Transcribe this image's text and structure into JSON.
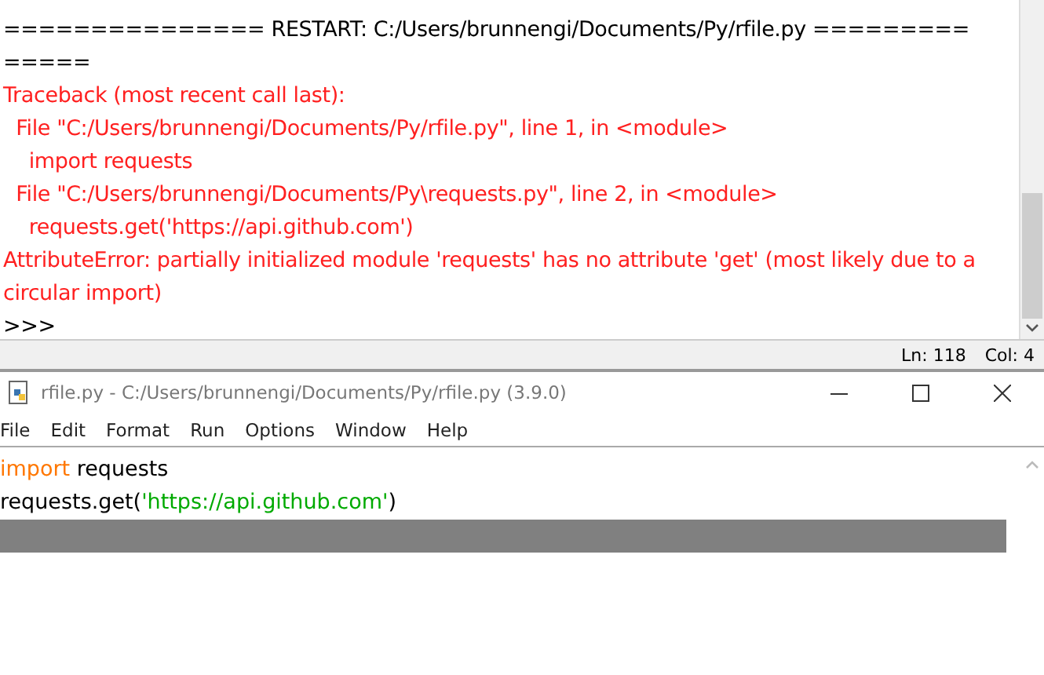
{
  "shell": {
    "lines": [
      {
        "kind": "header",
        "text": "=============== RESTART: C:/Users/brunnengi/Documents/Py/rfile.py ========="
      },
      {
        "kind": "header",
        "text": "====="
      },
      {
        "kind": "error",
        "text": "Traceback (most recent call last):"
      },
      {
        "kind": "error",
        "text": "  File \"C:/Users/brunnengi/Documents/Py/rfile.py\", line 1, in <module>"
      },
      {
        "kind": "error",
        "text": "    import requests"
      },
      {
        "kind": "error",
        "text": "  File \"C:/Users/brunnengi/Documents/Py\\requests.py\", line 2, in <module>"
      },
      {
        "kind": "error",
        "text": "    requests.get('https://api.github.com')"
      },
      {
        "kind": "error",
        "text": "AttributeError: partially initialized module 'requests' has no attribute 'get' (most likely due to a"
      },
      {
        "kind": "error",
        "text": "circular import)"
      },
      {
        "kind": "prompt",
        "text": ">>>"
      }
    ]
  },
  "status_bar": {
    "line": "Ln: 118",
    "column": "Col: 4"
  },
  "editor_window": {
    "title": "rfile.py - C:/Users/brunnengi/Documents/Py/rfile.py (3.9.0)",
    "menu": [
      "File",
      "Edit",
      "Format",
      "Run",
      "Options",
      "Window",
      "Help"
    ],
    "code_lines": [
      [
        {
          "kind": "keyword",
          "text": "import"
        },
        {
          "kind": "plain",
          "text": " requests"
        }
      ],
      [
        {
          "kind": "plain",
          "text": "requests.get("
        },
        {
          "kind": "string",
          "text": "'https://api.github.com'"
        },
        {
          "kind": "plain",
          "text": ")"
        }
      ]
    ]
  }
}
